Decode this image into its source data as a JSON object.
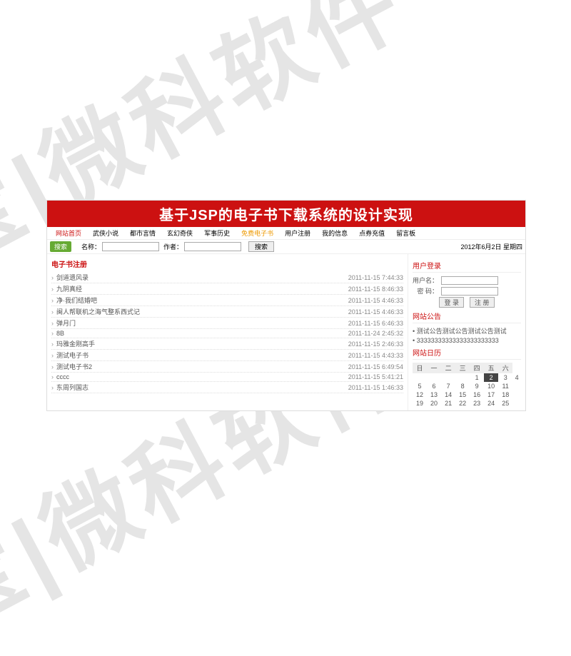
{
  "watermark": "宝|微科软件",
  "header": {
    "title": "基于JSP的电子书下载系统的设计实现"
  },
  "nav": {
    "items": [
      {
        "label": "网站首页",
        "cls": "home"
      },
      {
        "label": "武侠小说"
      },
      {
        "label": "都市言情"
      },
      {
        "label": "玄幻奇侠"
      },
      {
        "label": "军事历史"
      },
      {
        "label": "免费电子书",
        "cls": "hl"
      },
      {
        "label": "用户注册"
      },
      {
        "label": "我的信息"
      },
      {
        "label": "点券充值"
      },
      {
        "label": "留言板"
      }
    ]
  },
  "search": {
    "btn": "搜索",
    "name_label": "名称：",
    "author_label": "作者：",
    "go": "搜索",
    "date": "2012年6月2日 星期四"
  },
  "list": {
    "title": "电子书注册",
    "rows": [
      {
        "t": "剑道遗风录",
        "ts": "2011-11-15 7:44:33"
      },
      {
        "t": "九阴真经",
        "ts": "2011-11-15 8:46:33"
      },
      {
        "t": "净·我们结婚吧",
        "ts": "2011-11-15 4:46:33"
      },
      {
        "t": "闽人帮联机之海气整系西式记",
        "ts": "2011-11-15 4:46:33"
      },
      {
        "t": "弹月门",
        "ts": "2011-11-15 6:46:33"
      },
      {
        "t": "8B",
        "ts": "2011-11-24 2:45:32"
      },
      {
        "t": "玛雅金刚高手",
        "ts": "2011-11-15 2:46:33"
      },
      {
        "t": "测试电子书",
        "ts": "2011-11-15 4:43:33"
      },
      {
        "t": "测试电子书2",
        "ts": "2011-11-15 6:49:54"
      },
      {
        "t": "cccc",
        "ts": "2011-11-15 5:41:21"
      },
      {
        "t": "东周列国志",
        "ts": "2011-11-15 1:46:33"
      }
    ]
  },
  "login": {
    "title": "用户登录",
    "user_label": "用户名：",
    "pwd_label": "密 码：",
    "btn_login": "登 录",
    "btn_reg": "注 册"
  },
  "announce": {
    "title": "网站公告",
    "items": [
      "测试公告测试公告测试公告测试",
      "33333333333333333333333"
    ]
  },
  "calendar": {
    "title": "网站日历",
    "weekdays": [
      "日",
      "一",
      "二",
      "三",
      "四",
      "五",
      "六"
    ],
    "weeks": [
      [
        "",
        "",
        "",
        "",
        "1",
        "2",
        "3",
        "4"
      ],
      [
        "5",
        "6",
        "7",
        "8",
        "9",
        "10",
        "11"
      ],
      [
        "12",
        "13",
        "14",
        "15",
        "16",
        "17",
        "18"
      ],
      [
        "19",
        "20",
        "21",
        "22",
        "23",
        "24",
        "25"
      ]
    ],
    "today": "2"
  }
}
